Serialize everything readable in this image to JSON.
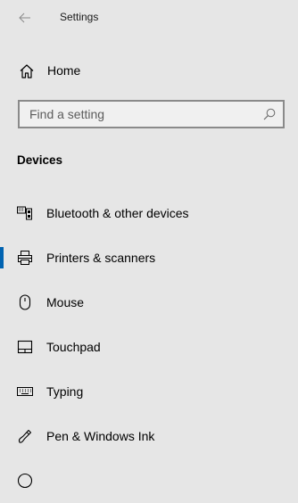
{
  "header": {
    "title": "Settings"
  },
  "home": {
    "label": "Home"
  },
  "search": {
    "placeholder": "Find a setting"
  },
  "section": {
    "title": "Devices"
  },
  "nav": {
    "items": [
      {
        "label": "Bluetooth & other devices",
        "icon": "bluetooth-devices-icon",
        "selected": false
      },
      {
        "label": "Printers & scanners",
        "icon": "printer-icon",
        "selected": true
      },
      {
        "label": "Mouse",
        "icon": "mouse-icon",
        "selected": false
      },
      {
        "label": "Touchpad",
        "icon": "touchpad-icon",
        "selected": false
      },
      {
        "label": "Typing",
        "icon": "keyboard-icon",
        "selected": false
      },
      {
        "label": "Pen & Windows Ink",
        "icon": "pen-icon",
        "selected": false
      }
    ]
  },
  "colors": {
    "accent": "#0063b1",
    "background": "#e6e6e6"
  }
}
